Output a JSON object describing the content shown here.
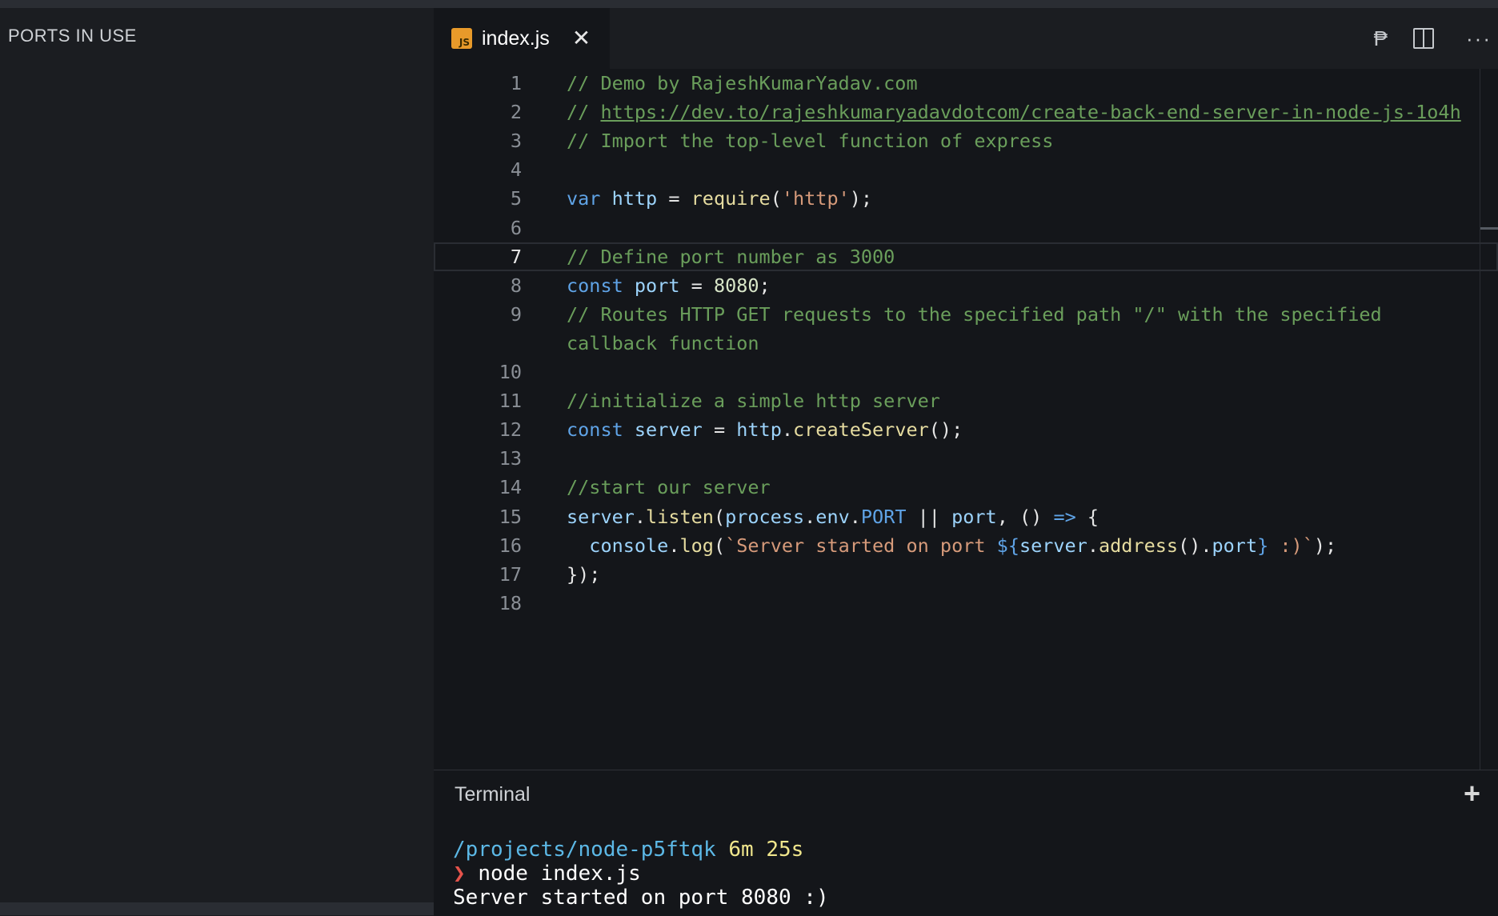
{
  "sidebar": {
    "title": "PORTS IN USE"
  },
  "tab": {
    "icon_text": "JS",
    "label": "index.js",
    "close_glyph": "✕"
  },
  "actions": {
    "paragraph_glyph": "₱",
    "more_glyph": "···"
  },
  "code_lines": [
    {
      "n": "1",
      "tokens": [
        [
          "cmt",
          "// Demo by RajeshKumarYadav.com"
        ]
      ]
    },
    {
      "n": "2",
      "tokens": [
        [
          "cmt",
          "// "
        ],
        [
          "lnk",
          "https://dev.to/rajeshkumaryadavdotcom/create-back-end-server-in-node-js-1o4h"
        ]
      ]
    },
    {
      "n": "3",
      "tokens": [
        [
          "cmt",
          "// Import the top-level function of express"
        ]
      ]
    },
    {
      "n": "4",
      "tokens": []
    },
    {
      "n": "5",
      "tokens": [
        [
          "kw",
          "var"
        ],
        [
          "txt",
          " "
        ],
        [
          "var",
          "http"
        ],
        [
          "txt",
          " = "
        ],
        [
          "fn",
          "require"
        ],
        [
          "txt",
          "("
        ],
        [
          "str",
          "'http'"
        ],
        [
          "txt",
          ");"
        ]
      ]
    },
    {
      "n": "6",
      "tokens": []
    },
    {
      "n": "7",
      "current": true,
      "tokens": [
        [
          "cmt",
          "// Define port number as 3000"
        ]
      ]
    },
    {
      "n": "8",
      "tokens": [
        [
          "kw",
          "const"
        ],
        [
          "txt",
          " "
        ],
        [
          "var",
          "port"
        ],
        [
          "txt",
          " = "
        ],
        [
          "num",
          "8080"
        ],
        [
          "txt",
          ";"
        ]
      ]
    },
    {
      "n": "9",
      "tokens": [
        [
          "cmt",
          "// Routes HTTP GET requests to the specified path \"/\" with the specified"
        ]
      ]
    },
    {
      "n": "",
      "tokens": [
        [
          "cmt",
          "callback function"
        ]
      ]
    },
    {
      "n": "10",
      "tokens": []
    },
    {
      "n": "11",
      "tokens": [
        [
          "cmt",
          "//initialize a simple http server"
        ]
      ]
    },
    {
      "n": "12",
      "tokens": [
        [
          "kw",
          "const"
        ],
        [
          "txt",
          " "
        ],
        [
          "var",
          "server"
        ],
        [
          "txt",
          " = "
        ],
        [
          "var",
          "http"
        ],
        [
          "txt",
          "."
        ],
        [
          "fn",
          "createServer"
        ],
        [
          "txt",
          "();"
        ]
      ]
    },
    {
      "n": "13",
      "tokens": []
    },
    {
      "n": "14",
      "tokens": [
        [
          "cmt",
          "//start our server"
        ]
      ]
    },
    {
      "n": "15",
      "tokens": [
        [
          "var",
          "server"
        ],
        [
          "txt",
          "."
        ],
        [
          "fn",
          "listen"
        ],
        [
          "txt",
          "("
        ],
        [
          "var",
          "process"
        ],
        [
          "txt",
          "."
        ],
        [
          "var",
          "env"
        ],
        [
          "txt",
          "."
        ],
        [
          "kw",
          "PORT"
        ],
        [
          "txt",
          " || "
        ],
        [
          "var",
          "port"
        ],
        [
          "txt",
          ", () "
        ],
        [
          "kw",
          "=>"
        ],
        [
          "txt",
          " {"
        ]
      ]
    },
    {
      "n": "16",
      "tokens": [
        [
          "txt",
          "  "
        ],
        [
          "var",
          "console"
        ],
        [
          "txt",
          "."
        ],
        [
          "fn",
          "log"
        ],
        [
          "txt",
          "("
        ],
        [
          "str",
          "`Server started on port "
        ],
        [
          "kw",
          "${"
        ],
        [
          "var",
          "server"
        ],
        [
          "txt",
          "."
        ],
        [
          "fn",
          "address"
        ],
        [
          "txt",
          "()."
        ],
        [
          "var",
          "port"
        ],
        [
          "kw",
          "}"
        ],
        [
          "str",
          " :)`"
        ],
        [
          "txt",
          ");"
        ]
      ]
    },
    {
      "n": "17",
      "tokens": [
        [
          "txt",
          "});"
        ]
      ]
    },
    {
      "n": "18",
      "tokens": []
    }
  ],
  "terminal": {
    "title": "Terminal",
    "add_glyph": "+",
    "path": "/projects/node-p5ftqk",
    "elapsed": "6m 25s",
    "prompt_glyph": "❯",
    "command": "node index.js",
    "output": "Server started on port 8080 :)"
  }
}
